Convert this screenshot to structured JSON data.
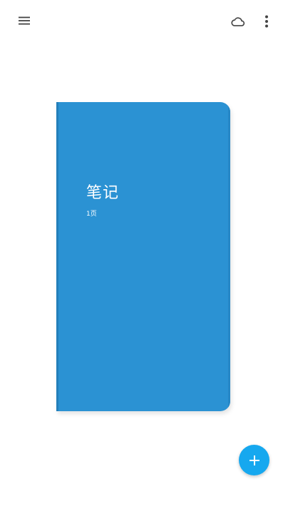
{
  "topbar": {
    "menu_icon": "hamburger-menu-icon",
    "cloud_icon": "cloud-sync-icon",
    "more_icon": "more-vertical-icon"
  },
  "notebook": {
    "title": "笔记",
    "pages": "1页",
    "color": "#2b92d3"
  },
  "fab": {
    "icon": "plus-icon",
    "color": "#16a8ef"
  }
}
